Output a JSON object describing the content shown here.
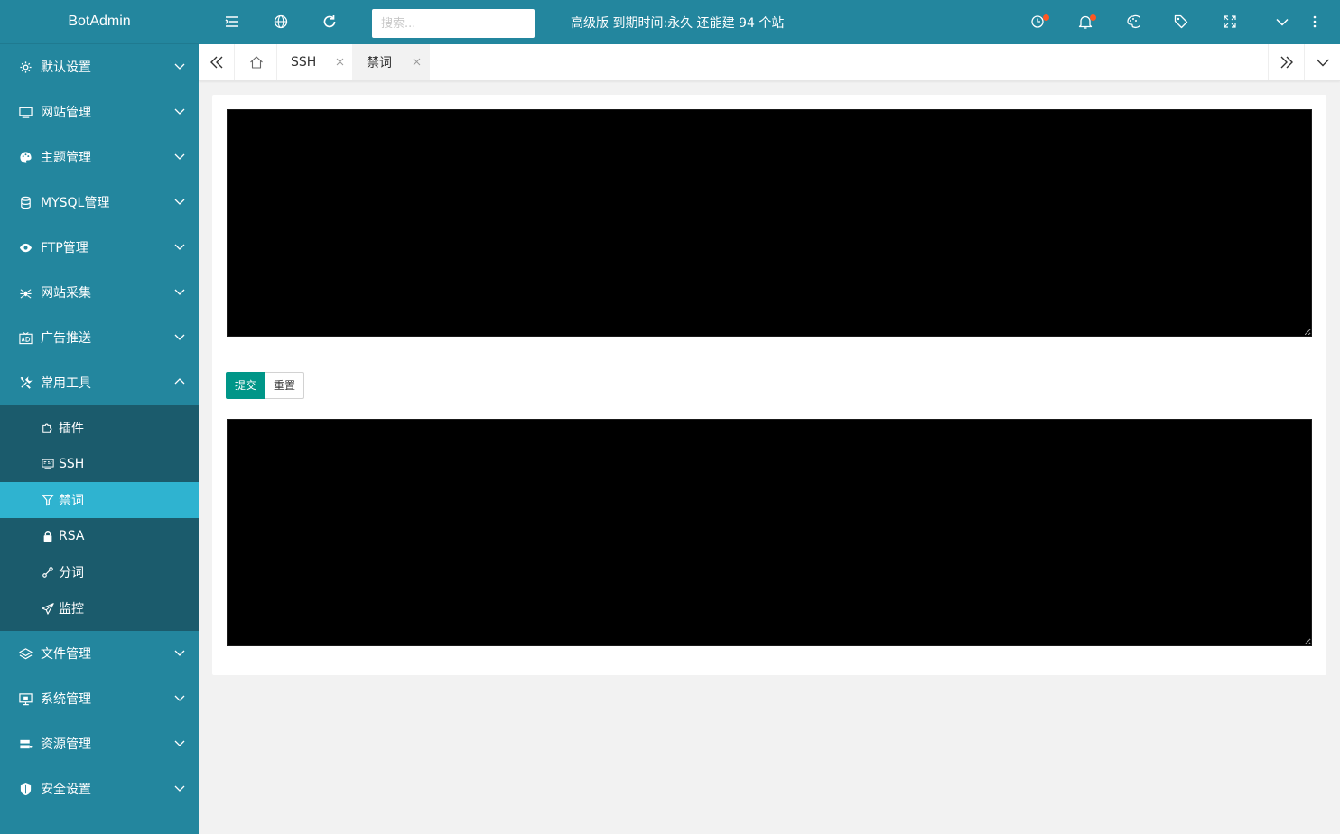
{
  "app": {
    "logo_text": "BotAdmin"
  },
  "header": {
    "search_placeholder": "搜索...",
    "notice": "高级版 到期时间:永久 还能建 94 个站",
    "icons": [
      "menu-toggle-icon",
      "globe-icon",
      "refresh-icon",
      "clock-icon",
      "bell-icon",
      "palette-icon",
      "tag-icon",
      "fullscreen-icon",
      "chevron-down-icon",
      "more-vertical-icon"
    ],
    "badge_color": "#ff5722"
  },
  "sidebar": {
    "items": [
      {
        "label": "默认设置",
        "icon": "gear-icon"
      },
      {
        "label": "网站管理",
        "icon": "monitor-icon"
      },
      {
        "label": "主题管理",
        "icon": "palette-icon"
      },
      {
        "label": "MYSQL管理",
        "icon": "database-icon"
      },
      {
        "label": "FTP管理",
        "icon": "eye-icon"
      },
      {
        "label": "网站采集",
        "icon": "spider-icon"
      },
      {
        "label": "广告推送",
        "icon": "ad-icon"
      },
      {
        "label": "常用工具",
        "icon": "tools-icon",
        "expanded": true
      },
      {
        "label": "文件管理",
        "icon": "layers-icon"
      },
      {
        "label": "系统管理",
        "icon": "desktop-icon"
      },
      {
        "label": "资源管理",
        "icon": "server-icon"
      },
      {
        "label": "安全设置",
        "icon": "shield-icon"
      }
    ],
    "tools_submenu": [
      {
        "label": "插件",
        "icon": "puzzle-icon"
      },
      {
        "label": "SSH",
        "icon": "ssh-icon"
      },
      {
        "label": "禁词",
        "icon": "filter-icon",
        "active": true
      },
      {
        "label": "RSA",
        "icon": "lock-icon"
      },
      {
        "label": "分词",
        "icon": "link-icon"
      },
      {
        "label": "监控",
        "icon": "send-icon"
      }
    ]
  },
  "tabs": {
    "items": [
      {
        "label": "SSH"
      },
      {
        "label": "禁词",
        "active": true
      }
    ]
  },
  "content": {
    "editor_top_value": "",
    "editor_bottom_value": "",
    "submit_label": "提交",
    "reset_label": "重置"
  },
  "colors": {
    "sidebar_bg": "#23869e",
    "submenu_bg": "#1b5b6c",
    "active_item": "#2fb3d0",
    "primary_button": "#009688"
  }
}
